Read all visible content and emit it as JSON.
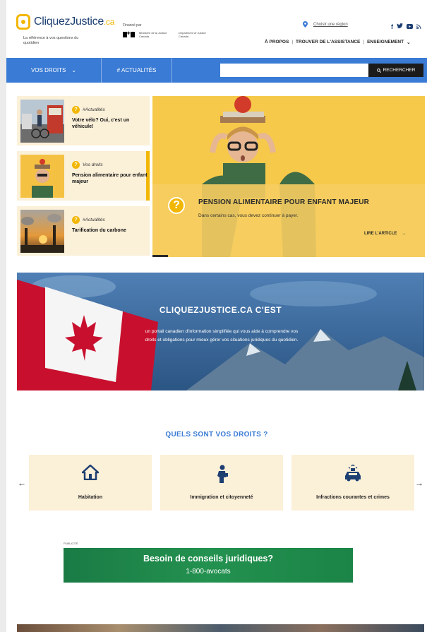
{
  "brand": {
    "logo_main": "CliquezJustice",
    "logo_suffix": ".ca",
    "tagline": "La référence à vos questions du quotidien"
  },
  "funding": {
    "label": "Financé par",
    "dept_fr": "Ministère de la Justice Canada",
    "dept_en": "Department of Justice Canada"
  },
  "region": {
    "label": "Choisir une région"
  },
  "social": [
    "f",
    "t",
    "yt",
    "rss"
  ],
  "topnav": {
    "about": "À PROPOS",
    "help": "TROUVER DE L'ASSISTANCE",
    "teaching": "ENSEIGNEMENT"
  },
  "mainnav": {
    "rights": "VOS DROITS",
    "news": "ACTUALITÉS",
    "search_placeholder": "",
    "search_button": "RECHERCHER"
  },
  "cards": [
    {
      "category": "#Actualités",
      "title": "Votre vélo? Oui, c'est un véhicule!"
    },
    {
      "category": "Vos droits",
      "title": "Pension alimentaire pour enfant majeur"
    },
    {
      "category": "#Actualités",
      "title": "Tarification du carbone"
    }
  ],
  "hero": {
    "title": "PENSION ALIMENTAIRE POUR ENFANT MAJEUR",
    "subtitle": "Dans certains cas, vous devez continuer à payer.",
    "read_more": "LIRE L'ARTICLE"
  },
  "about": {
    "title": "CLIQUEZJUSTICE.CA C'EST",
    "text": "un portail canadien d'information simplifiée qui vous aide à comprendre vos droits et obligations pour mieux gérer vos situations juridiques du quotidien."
  },
  "rights": {
    "title": "QUELS SONT VOS DROITS ?",
    "tiles": [
      {
        "label": "Habitation",
        "icon": "house-icon"
      },
      {
        "label": "Immigration et citoyenneté",
        "icon": "person-icon"
      },
      {
        "label": "Infractions courantes et crimes",
        "icon": "police-car-icon"
      }
    ]
  },
  "ad": {
    "label": "PUBLICITÉ",
    "title": "Besoin de conseils juridiques?",
    "phone": "1-800-avocats"
  },
  "colors": {
    "accent_blue": "#3a7bd5",
    "accent_yellow": "#f2b705",
    "navy": "#1d3f72"
  }
}
